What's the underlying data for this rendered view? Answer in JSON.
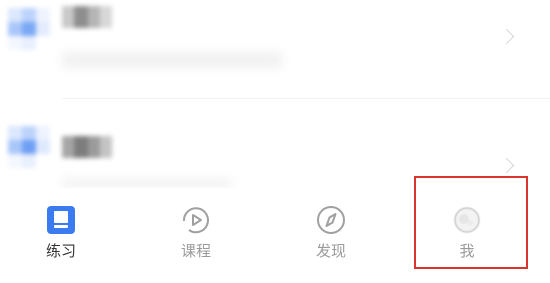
{
  "tabbar": {
    "tabs": [
      {
        "label": "练习",
        "icon": "practice-icon",
        "active": true
      },
      {
        "label": "课程",
        "icon": "course-play-icon",
        "active": false
      },
      {
        "label": "发现",
        "icon": "compass-icon",
        "active": false
      },
      {
        "label": "我",
        "icon": "me-avatar-icon",
        "active": false
      }
    ]
  },
  "colors": {
    "active_icon": "#3b7bf0",
    "inactive": "#9a9a9a",
    "active_label": "#333333",
    "highlight_box": "#d9352c",
    "avatar_blue": "#7aa8f5"
  }
}
